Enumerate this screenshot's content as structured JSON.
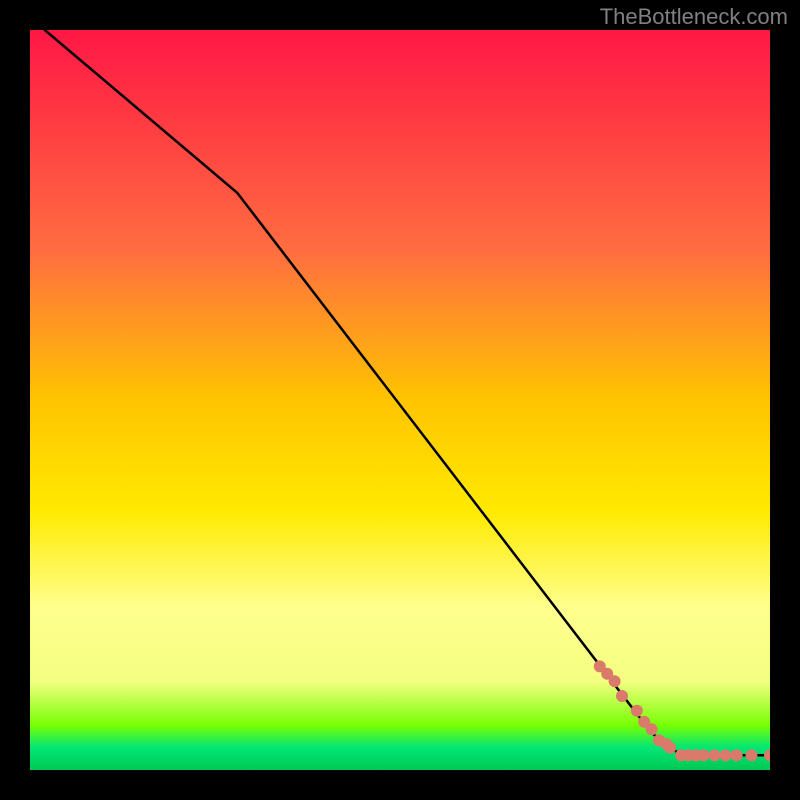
{
  "watermark": "TheBottleneck.com",
  "chart_data": {
    "type": "line",
    "title": "",
    "xlabel": "",
    "ylabel": "",
    "xlim": [
      0,
      100
    ],
    "ylim": [
      0,
      100
    ],
    "gradient_background": {
      "stops": [
        {
          "pos": 0,
          "color": "#ff1744"
        },
        {
          "pos": 30,
          "color": "#ff6e40"
        },
        {
          "pos": 50,
          "color": "#ffc400"
        },
        {
          "pos": 65,
          "color": "#ffea00"
        },
        {
          "pos": 78,
          "color": "#ffff8d"
        },
        {
          "pos": 88,
          "color": "#f4ff81"
        },
        {
          "pos": 94,
          "color": "#76ff03"
        },
        {
          "pos": 97,
          "color": "#00e676"
        },
        {
          "pos": 100,
          "color": "#00c853"
        }
      ]
    },
    "series": [
      {
        "name": "curve",
        "type": "line",
        "color": "#000000",
        "points": [
          {
            "x": 2,
            "y": 100
          },
          {
            "x": 28,
            "y": 78
          },
          {
            "x": 84,
            "y": 5
          },
          {
            "x": 88,
            "y": 2
          },
          {
            "x": 100,
            "y": 2
          }
        ]
      },
      {
        "name": "markers",
        "type": "scatter",
        "color": "#d97a6a",
        "points": [
          {
            "x": 77,
            "y": 14
          },
          {
            "x": 78,
            "y": 13
          },
          {
            "x": 79,
            "y": 12
          },
          {
            "x": 80,
            "y": 10
          },
          {
            "x": 82,
            "y": 8
          },
          {
            "x": 83,
            "y": 6.5
          },
          {
            "x": 84,
            "y": 5.5
          },
          {
            "x": 85,
            "y": 4
          },
          {
            "x": 86,
            "y": 3.5
          },
          {
            "x": 86.5,
            "y": 3
          },
          {
            "x": 88,
            "y": 2
          },
          {
            "x": 89,
            "y": 2
          },
          {
            "x": 90,
            "y": 2
          },
          {
            "x": 91,
            "y": 2
          },
          {
            "x": 92.5,
            "y": 2
          },
          {
            "x": 94,
            "y": 2
          },
          {
            "x": 95.5,
            "y": 2
          },
          {
            "x": 97.5,
            "y": 2
          },
          {
            "x": 100,
            "y": 2
          }
        ]
      }
    ]
  }
}
